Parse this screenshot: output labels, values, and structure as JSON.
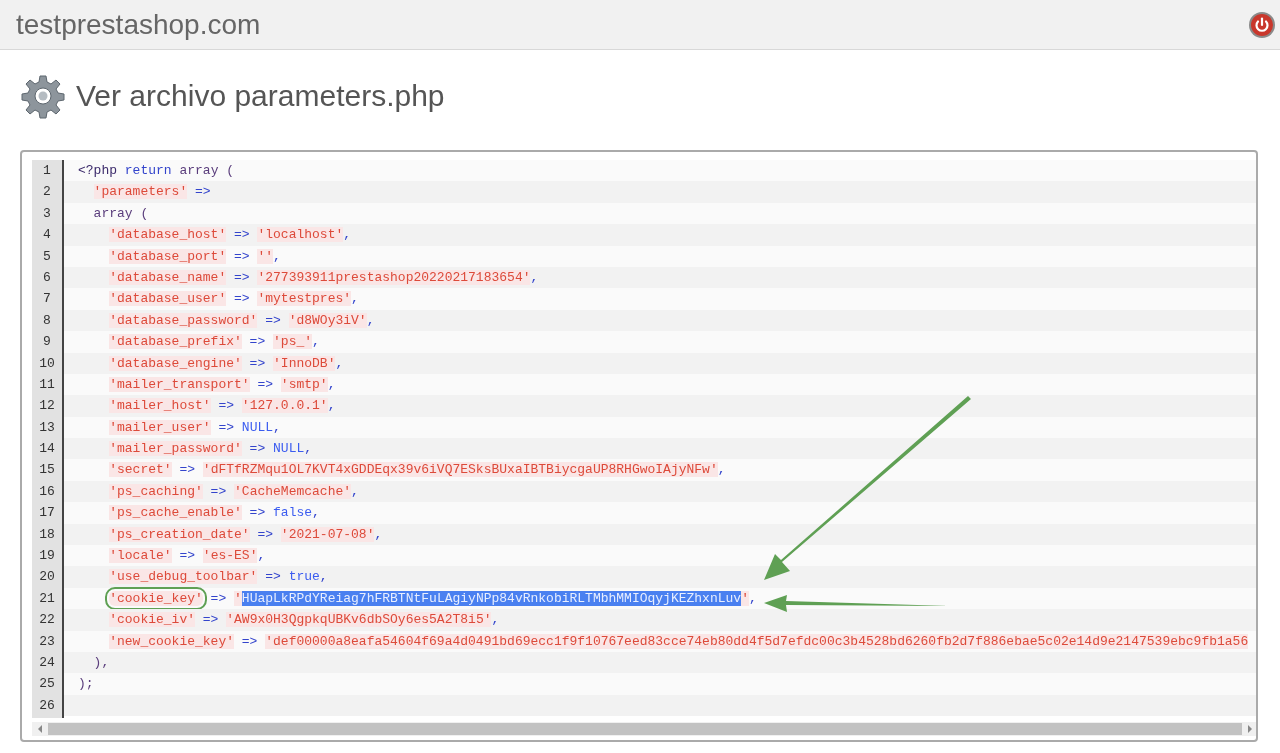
{
  "header": {
    "site": "testprestashop.com"
  },
  "page": {
    "title": "Ver archivo parameters.php"
  },
  "code": {
    "lines": [
      {
        "number": "1",
        "tokens": [
          {
            "kind": "tag",
            "text": "<?php "
          },
          {
            "kind": "keyword",
            "text": "return "
          },
          {
            "kind": "plain",
            "text": "array ("
          }
        ],
        "children": [
          {
            "number": "2",
            "tokens": [
              {
                "kind": "string",
                "text": "'parameters'"
              },
              {
                "kind": "operator",
                "text": " =>"
              }
            ]
          },
          {
            "number": "3",
            "tokens": [
              {
                "kind": "plain",
                "text": "array ("
              }
            ],
            "children": [
              {
                "number": "4",
                "tokens": [
                  {
                    "kind": "string",
                    "text": "'database_host'"
                  },
                  {
                    "kind": "operator",
                    "text": " => "
                  },
                  {
                    "kind": "string",
                    "text": "'localhost'"
                  },
                  {
                    "kind": "punct",
                    "text": ","
                  }
                ]
              },
              {
                "number": "5",
                "tokens": [
                  {
                    "kind": "string",
                    "text": "'database_port'"
                  },
                  {
                    "kind": "operator",
                    "text": " => "
                  },
                  {
                    "kind": "string",
                    "text": "''"
                  },
                  {
                    "kind": "punct",
                    "text": ","
                  }
                ]
              },
              {
                "number": "6",
                "tokens": [
                  {
                    "kind": "string",
                    "text": "'database_name'"
                  },
                  {
                    "kind": "operator",
                    "text": " => "
                  },
                  {
                    "kind": "string",
                    "text": "'277393911prestashop20220217183654'"
                  },
                  {
                    "kind": "punct",
                    "text": ","
                  }
                ]
              },
              {
                "number": "7",
                "tokens": [
                  {
                    "kind": "string",
                    "text": "'database_user'"
                  },
                  {
                    "kind": "operator",
                    "text": " => "
                  },
                  {
                    "kind": "string",
                    "text": "'mytestpres'"
                  },
                  {
                    "kind": "punct",
                    "text": ","
                  }
                ]
              },
              {
                "number": "8",
                "tokens": [
                  {
                    "kind": "string",
                    "text": "'database_password'"
                  },
                  {
                    "kind": "operator",
                    "text": " => "
                  },
                  {
                    "kind": "string",
                    "text": "'d8WOy3iV'"
                  },
                  {
                    "kind": "punct",
                    "text": ","
                  }
                ]
              },
              {
                "number": "9",
                "tokens": [
                  {
                    "kind": "string",
                    "text": "'database_prefix'"
                  },
                  {
                    "kind": "operator",
                    "text": " => "
                  },
                  {
                    "kind": "string",
                    "text": "'ps_'"
                  },
                  {
                    "kind": "punct",
                    "text": ","
                  }
                ]
              },
              {
                "number": "10",
                "tokens": [
                  {
                    "kind": "string",
                    "text": "'database_engine'"
                  },
                  {
                    "kind": "operator",
                    "text": " => "
                  },
                  {
                    "kind": "string",
                    "text": "'InnoDB'"
                  },
                  {
                    "kind": "punct",
                    "text": ","
                  }
                ]
              },
              {
                "number": "11",
                "tokens": [
                  {
                    "kind": "string",
                    "text": "'mailer_transport'"
                  },
                  {
                    "kind": "operator",
                    "text": " => "
                  },
                  {
                    "kind": "string",
                    "text": "'smtp'"
                  },
                  {
                    "kind": "punct",
                    "text": ","
                  }
                ]
              },
              {
                "number": "12",
                "tokens": [
                  {
                    "kind": "string",
                    "text": "'mailer_host'"
                  },
                  {
                    "kind": "operator",
                    "text": " => "
                  },
                  {
                    "kind": "string",
                    "text": "'127.0.0.1'"
                  },
                  {
                    "kind": "punct",
                    "text": ","
                  }
                ]
              },
              {
                "number": "13",
                "tokens": [
                  {
                    "kind": "string",
                    "text": "'mailer_user'"
                  },
                  {
                    "kind": "operator",
                    "text": " => "
                  },
                  {
                    "kind": "constant",
                    "text": "NULL"
                  },
                  {
                    "kind": "punct",
                    "text": ","
                  }
                ]
              },
              {
                "number": "14",
                "tokens": [
                  {
                    "kind": "string",
                    "text": "'mailer_password'"
                  },
                  {
                    "kind": "operator",
                    "text": " => "
                  },
                  {
                    "kind": "constant",
                    "text": "NULL"
                  },
                  {
                    "kind": "punct",
                    "text": ","
                  }
                ]
              },
              {
                "number": "15",
                "tokens": [
                  {
                    "kind": "string",
                    "text": "'secret'"
                  },
                  {
                    "kind": "operator",
                    "text": " => "
                  },
                  {
                    "kind": "string",
                    "text": "'dFTfRZMqu1OL7KVT4xGDDEqx39v6iVQ7ESksBUxaIBTBiycgaUP8RHGwoIAjyNFw'"
                  },
                  {
                    "kind": "punct",
                    "text": ","
                  }
                ]
              },
              {
                "number": "16",
                "tokens": [
                  {
                    "kind": "string",
                    "text": "'ps_caching'"
                  },
                  {
                    "kind": "operator",
                    "text": " => "
                  },
                  {
                    "kind": "string",
                    "text": "'CacheMemcache'"
                  },
                  {
                    "kind": "punct",
                    "text": ","
                  }
                ]
              },
              {
                "number": "17",
                "tokens": [
                  {
                    "kind": "string",
                    "text": "'ps_cache_enable'"
                  },
                  {
                    "kind": "operator",
                    "text": " => "
                  },
                  {
                    "kind": "constant",
                    "text": "false"
                  },
                  {
                    "kind": "punct",
                    "text": ","
                  }
                ]
              },
              {
                "number": "18",
                "tokens": [
                  {
                    "kind": "string",
                    "text": "'ps_creation_date'"
                  },
                  {
                    "kind": "operator",
                    "text": " => "
                  },
                  {
                    "kind": "string",
                    "text": "'2021-07-08'"
                  },
                  {
                    "kind": "punct",
                    "text": ","
                  }
                ]
              },
              {
                "number": "19",
                "tokens": [
                  {
                    "kind": "string",
                    "text": "'locale'"
                  },
                  {
                    "kind": "operator",
                    "text": " => "
                  },
                  {
                    "kind": "string",
                    "text": "'es-ES'"
                  },
                  {
                    "kind": "punct",
                    "text": ","
                  }
                ]
              },
              {
                "number": "20",
                "tokens": [
                  {
                    "kind": "string",
                    "text": "'use_debug_toolbar'"
                  },
                  {
                    "kind": "operator",
                    "text": " => "
                  },
                  {
                    "kind": "constant",
                    "text": "true"
                  },
                  {
                    "kind": "punct",
                    "text": ","
                  }
                ]
              },
              {
                "number": "21",
                "tokens": [
                  {
                    "kind": "string",
                    "text": "'cookie_key'",
                    "circled": true
                  },
                  {
                    "kind": "operator",
                    "text": " => "
                  },
                  {
                    "kind": "string",
                    "text": "'"
                  },
                  {
                    "kind": "selection",
                    "text": "HUapLkRPdYReiag7hFRBTNtFuLAgiyNPp84vRnkobiRLTMbhMMIOqyjKEZhxnLuv"
                  },
                  {
                    "kind": "string",
                    "text": "'"
                  },
                  {
                    "kind": "punct",
                    "text": ","
                  }
                ]
              },
              {
                "number": "22",
                "tokens": [
                  {
                    "kind": "string",
                    "text": "'cookie_iv'"
                  },
                  {
                    "kind": "operator",
                    "text": " => "
                  },
                  {
                    "kind": "string",
                    "text": "'AW9x0H3QgpkqUBKv6dbSOy6es5A2T8i5'"
                  },
                  {
                    "kind": "punct",
                    "text": ","
                  }
                ]
              },
              {
                "number": "23",
                "tokens": [
                  {
                    "kind": "string",
                    "text": "'new_cookie_key'"
                  },
                  {
                    "kind": "operator",
                    "text": " => "
                  },
                  {
                    "kind": "string",
                    "text": "'def00000a8eafa54604f69a4d0491bd69ecc1f9f10767eed83cce74eb80dd4f5d7efdc00c3b4528bd6260fb2d7f886ebae5c02e14d9e2147539ebc9fb1a56"
                  }
                ]
              }
            ]
          },
          {
            "number": "24",
            "tokens": [
              {
                "kind": "plain",
                "text": "),"
              }
            ]
          }
        ]
      },
      {
        "number": "25",
        "tokens": [
          {
            "kind": "plain",
            "text": ");"
          }
        ]
      },
      {
        "number": "26"
      }
    ]
  }
}
